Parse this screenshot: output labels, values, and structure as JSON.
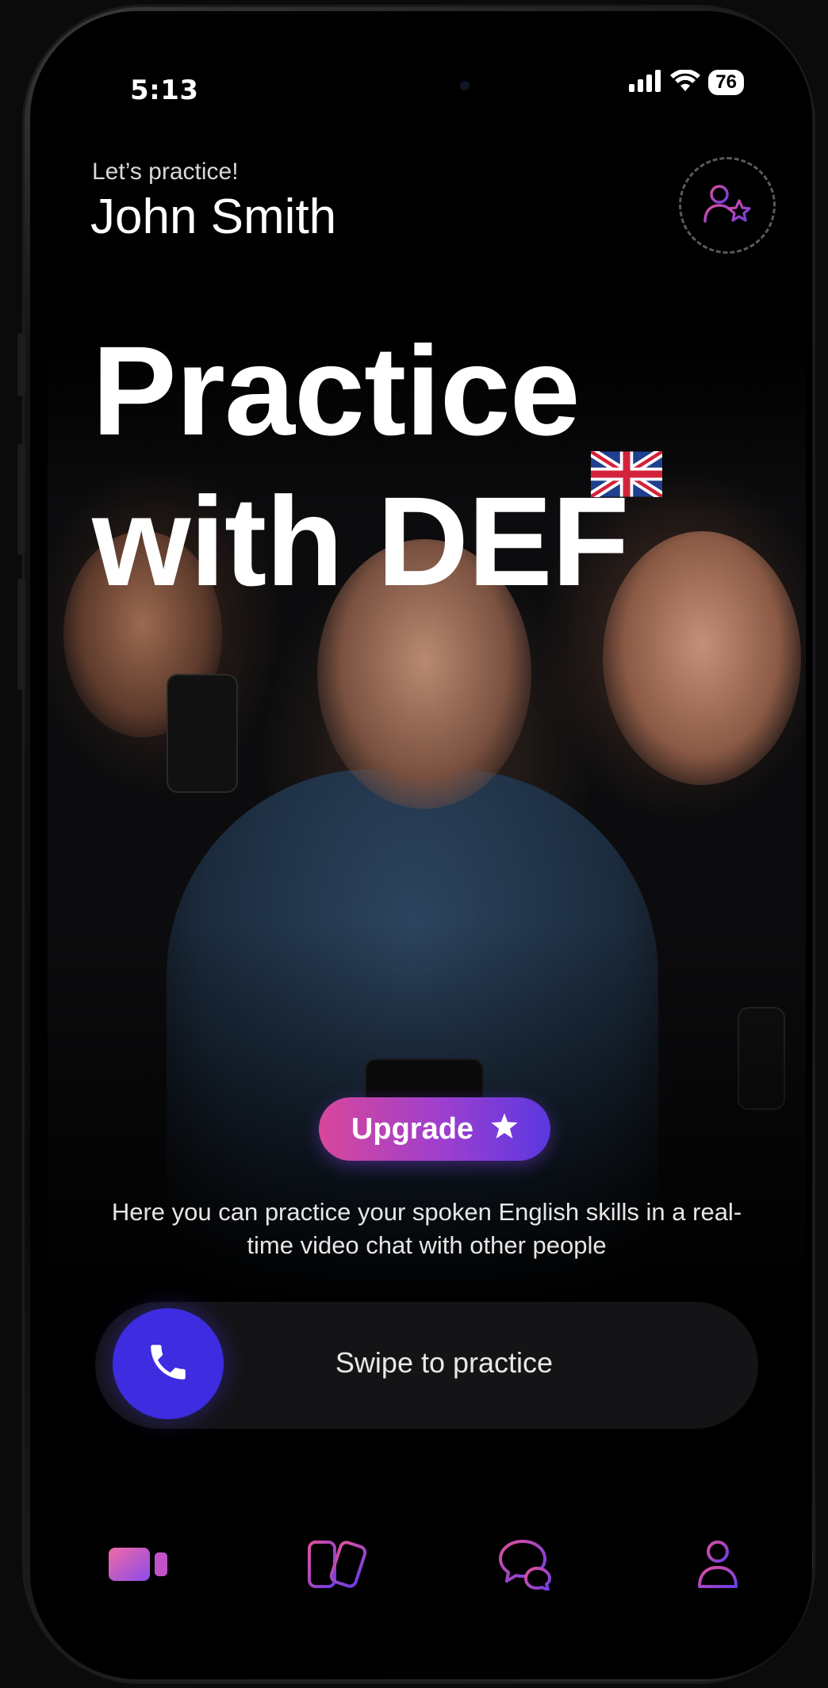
{
  "status_bar": {
    "time": "5:13",
    "battery": "76",
    "icons": [
      "signal-icon",
      "wifi-icon",
      "battery-icon"
    ]
  },
  "header": {
    "greeting": "Let’s practice!",
    "user_name": "John Smith",
    "profile_button_icon": "user-star-icon"
  },
  "hero": {
    "headline_line1": "Practice",
    "headline_line2": "with DEF",
    "flag_icon": "uk-flag-icon"
  },
  "upgrade": {
    "label": "Upgrade",
    "icon": "star-icon"
  },
  "description": "Here you can practice your spoken English skills in a real-time video chat with other people",
  "swipe": {
    "label": "Swipe to practice",
    "icon": "phone-icon"
  },
  "bottom_nav": {
    "items": [
      {
        "icon": "video-icon",
        "active": true
      },
      {
        "icon": "cards-icon",
        "active": false
      },
      {
        "icon": "chat-icon",
        "active": false
      },
      {
        "icon": "profile-icon",
        "active": false
      }
    ]
  },
  "colors": {
    "accent_start": "#d8479a",
    "accent_mid": "#9b3fd0",
    "accent_end": "#5b37e0",
    "swipe_knob": "#3d2ce0",
    "background": "#000000"
  }
}
